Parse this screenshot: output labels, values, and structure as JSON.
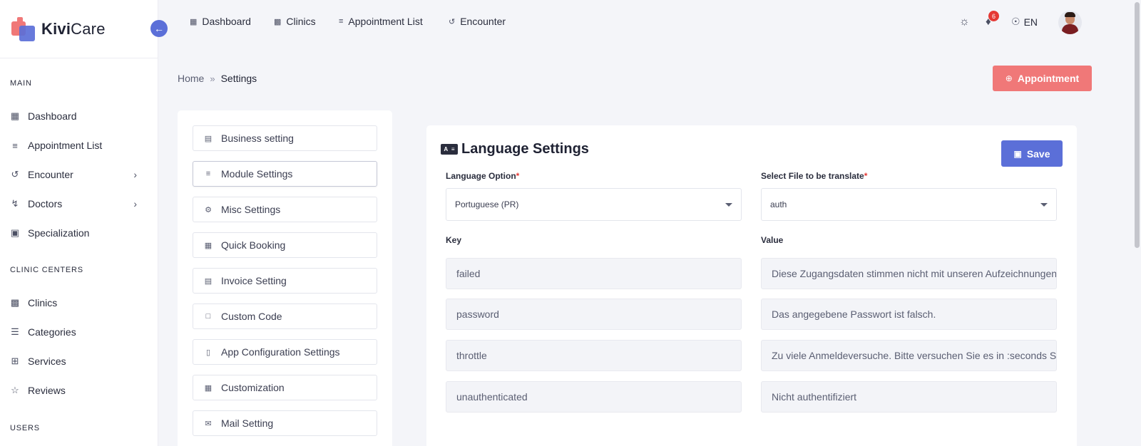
{
  "brand": {
    "name_bold": "Kivi",
    "name_regular": "Care"
  },
  "sidebar": {
    "sections": [
      {
        "label": "MAIN"
      },
      {
        "label": "CLINIC CENTERS"
      },
      {
        "label": "USERS"
      }
    ],
    "items": [
      {
        "label": "Dashboard",
        "icon": "dashboard-icon"
      },
      {
        "label": "Appointment List",
        "icon": "sliders-icon"
      },
      {
        "label": "Encounter",
        "icon": "history-icon"
      },
      {
        "label": "Doctors",
        "icon": "stethoscope-icon"
      },
      {
        "label": "Specialization",
        "icon": "specialization-icon"
      },
      {
        "label": "Clinics",
        "icon": "building-icon"
      },
      {
        "label": "Categories",
        "icon": "list-icon"
      },
      {
        "label": "Services",
        "icon": "briefcase-plus-icon"
      },
      {
        "label": "Reviews",
        "icon": "star-icon"
      }
    ]
  },
  "topnav": {
    "links": [
      {
        "label": "Dashboard"
      },
      {
        "label": "Clinics"
      },
      {
        "label": "Appointment List"
      },
      {
        "label": "Encounter"
      }
    ],
    "notification_count": "6",
    "language": "EN"
  },
  "breadcrumb": {
    "home": "Home",
    "current": "Settings"
  },
  "appointment_button": "Appointment",
  "settings_menu": [
    {
      "label": "Business setting"
    },
    {
      "label": "Module Settings"
    },
    {
      "label": "Misc Settings"
    },
    {
      "label": "Quick Booking"
    },
    {
      "label": "Invoice Setting"
    },
    {
      "label": "Custom Code"
    },
    {
      "label": "App Configuration Settings"
    },
    {
      "label": "Customization"
    },
    {
      "label": "Mail Setting"
    }
  ],
  "language_settings": {
    "title": "Language Settings",
    "save_label": "Save",
    "language_option_label": "Language Option",
    "language_option_value": "Portuguese (PR)",
    "file_label": "Select File to be translate",
    "file_value": "auth",
    "key_header": "Key",
    "value_header": "Value",
    "rows": [
      {
        "key": "failed",
        "value": "Diese Zugangsdaten stimmen nicht mit unseren Aufzeichnungen überein."
      },
      {
        "key": "password",
        "value": "Das angegebene Passwort ist falsch."
      },
      {
        "key": "throttle",
        "value": "Zu viele Anmeldeversuche. Bitte versuchen Sie es in :seconds Sekunden erneut."
      },
      {
        "key": "unauthenticated",
        "value": "Nicht authentifiziert"
      }
    ]
  },
  "colors": {
    "primary": "#5b6fd8",
    "accent": "#f07878",
    "required": "#e53935"
  }
}
